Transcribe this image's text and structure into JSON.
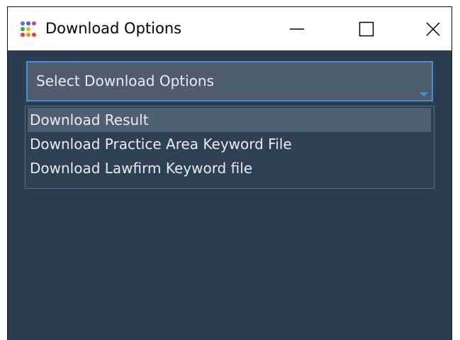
{
  "window": {
    "title": "Download Options",
    "controls": {
      "minimize_icon": "minimize-icon",
      "maximize_icon": "maximize-icon",
      "close_icon": "close-icon"
    }
  },
  "combo": {
    "placeholder": "Select Download Options"
  },
  "dropdown": {
    "items": [
      {
        "label": "Download Result",
        "selected": true
      },
      {
        "label": "Download Practice Area Keyword File",
        "selected": false
      },
      {
        "label": "Download Lawfirm Keyword file",
        "selected": false
      }
    ]
  },
  "colors": {
    "background": "#2b3d4f",
    "combo_bg": "#4e5d6d",
    "combo_border": "#4a8fd6",
    "highlight": "#506071",
    "text": "#e8ecef"
  }
}
